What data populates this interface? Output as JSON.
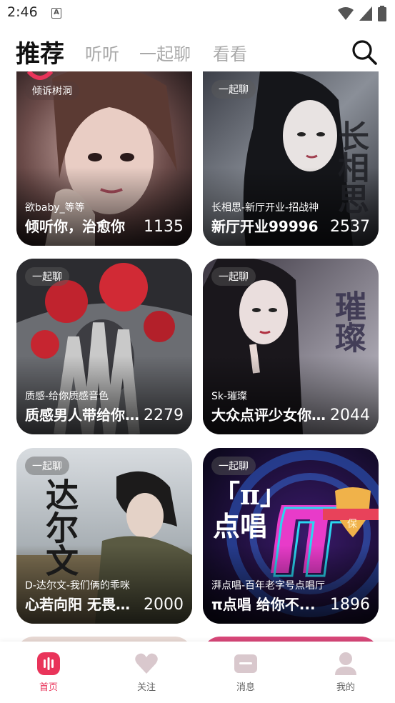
{
  "status_bar": {
    "time": "2:46",
    "a_badge": "A"
  },
  "tabs": [
    {
      "label": "推荐",
      "active": true
    },
    {
      "label": "听听",
      "active": false
    },
    {
      "label": "一起聊",
      "active": false
    },
    {
      "label": "看看",
      "active": false
    }
  ],
  "cards": [
    {
      "tag": "倾诉树洞",
      "host": "欲baby_等等",
      "title": "倾听你，治愈你",
      "count": "1135"
    },
    {
      "tag": "一起聊",
      "host": "长相思-新厅开业-招战神",
      "title": "新厅开业99996",
      "count": "2537",
      "art_text": "长相思"
    },
    {
      "tag": "一起聊",
      "host": "质感-给你质感音色",
      "title": "质感男人带给你...",
      "count": "2279"
    },
    {
      "tag": "一起聊",
      "host": "Sk-璀璨",
      "title": "大众点评少女你...",
      "count": "2044",
      "art_text": "璀璨"
    },
    {
      "tag": "一起聊",
      "host": "D-达尔文-我们俩的乖咪",
      "title": "心若向阳 无畏悲...",
      "count": "2000",
      "art_text": "达尔文"
    },
    {
      "tag": "一起聊",
      "host": "湃点唱-百年老字号点唱厅",
      "title": "π点唱 给你不...",
      "count": "1896",
      "art_text": "「π」点唱",
      "badge": "保"
    }
  ],
  "bottom_nav": [
    {
      "label": "首页",
      "icon": "home-live-icon",
      "active": true
    },
    {
      "label": "关注",
      "icon": "heart-icon",
      "active": false
    },
    {
      "label": "消息",
      "icon": "message-icon",
      "active": false
    },
    {
      "label": "我的",
      "icon": "profile-icon",
      "active": false
    }
  ],
  "colors": {
    "accent": "#e9345a",
    "inactive_icon": "#d9c8cd"
  }
}
